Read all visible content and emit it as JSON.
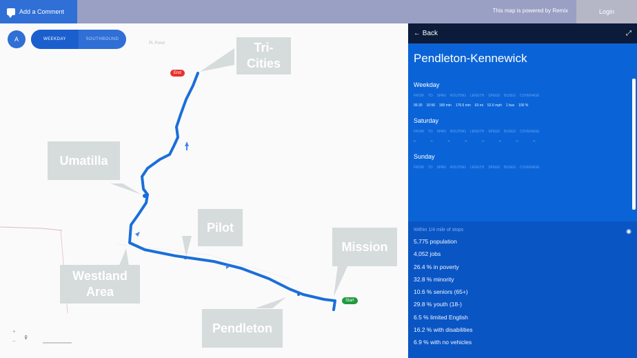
{
  "topbar": {
    "comment_label": "Add a Comment",
    "powered_text": "This map is powered by Remix",
    "login_label": "Login"
  },
  "map": {
    "zoom_label": "A",
    "direction_toggle": {
      "active": "WEEKDAY",
      "inactive": "SOUTHBOUND"
    },
    "places": [
      {
        "name": "Tri-Cities",
        "lines": [
          "Tri-",
          "Cities"
        ]
      },
      {
        "name": "Umatilla"
      },
      {
        "name": "Pilot"
      },
      {
        "name": "Mission"
      },
      {
        "name": "Westland Area",
        "lines": [
          "Westland",
          "Area"
        ]
      },
      {
        "name": "Pendleton"
      }
    ],
    "end_pin": "End",
    "start_pin": "Start",
    "route_color": "#1a6fd9",
    "faint_label": "Pl. Pond"
  },
  "panel": {
    "back_label": "Back",
    "title": "Pendleton-Kennewick",
    "columns": [
      "FROM",
      "TO",
      "SPAN",
      "ROUTING",
      "LENGTH",
      "SPEED",
      "BUSES",
      "COVERAGE"
    ],
    "weekday": {
      "label": "Weekday",
      "values": [
        "06:30",
        "16:56",
        "180 min",
        "176.6 min",
        "63 mi",
        "52.6 mph",
        "1 bus",
        "100 %"
      ]
    },
    "saturday": {
      "label": "Saturday",
      "values": [
        "–",
        "–",
        "–",
        "–",
        "–",
        "–",
        "–",
        "–"
      ]
    },
    "sunday": {
      "label": "Sunday"
    },
    "impact": {
      "title": "Within 1/4 mile of stops",
      "items": [
        "5,775 population",
        "4,052 jobs",
        "26.4 % in poverty",
        "32.8 % minority",
        "10.6 % seniors (65+)",
        "29.8 % youth (18-)",
        "6.5 % limited English",
        "16.2 % with disabilities",
        "6.9 % with no vehicles"
      ]
    }
  }
}
